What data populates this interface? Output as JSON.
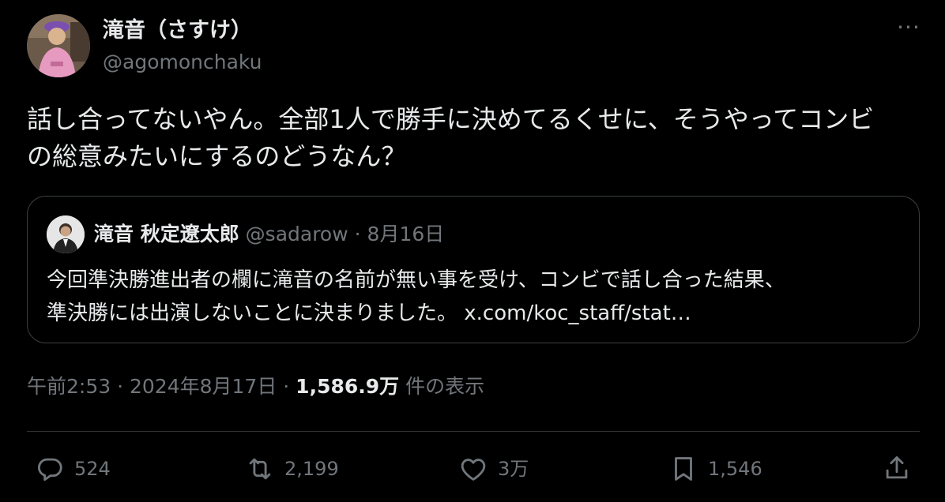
{
  "author": {
    "display_name": "滝音（さすけ）",
    "handle": "@agomonchaku"
  },
  "more_label": "···",
  "tweet_text_line1": "話し合ってないやん。全部1人で勝手に決めてるくせに、そうやってコンビ",
  "tweet_text_line2": "の総意みたいにするのどうなん？",
  "quote": {
    "display_name": "滝音 秋定遼太郎",
    "handle": "@sadarow",
    "dot": "·",
    "date": "8月16日",
    "text_line1": "今回準決勝進出者の欄に滝音の名前が無い事を受け、コンビで話し合った結果、",
    "text_line2": "準決勝には出演しないことに決まりました。",
    "link": "x.com/koc_staff/stat…"
  },
  "meta": {
    "time": "午前2:53",
    "sep1": " · ",
    "date": "2024年8月17日",
    "sep2": " · ",
    "views": "1,586.9万",
    "views_label": " 件の表示"
  },
  "actions": {
    "replies": "524",
    "reposts": "2,199",
    "likes": "3万",
    "bookmarks": "1,546"
  },
  "colors": {
    "background": "#000000",
    "text": "#e7e9ea",
    "muted": "#71767b",
    "border": "#2f3336"
  },
  "icons": [
    "reply-icon",
    "repost-icon",
    "like-icon",
    "bookmark-icon",
    "share-icon",
    "more-icon"
  ]
}
